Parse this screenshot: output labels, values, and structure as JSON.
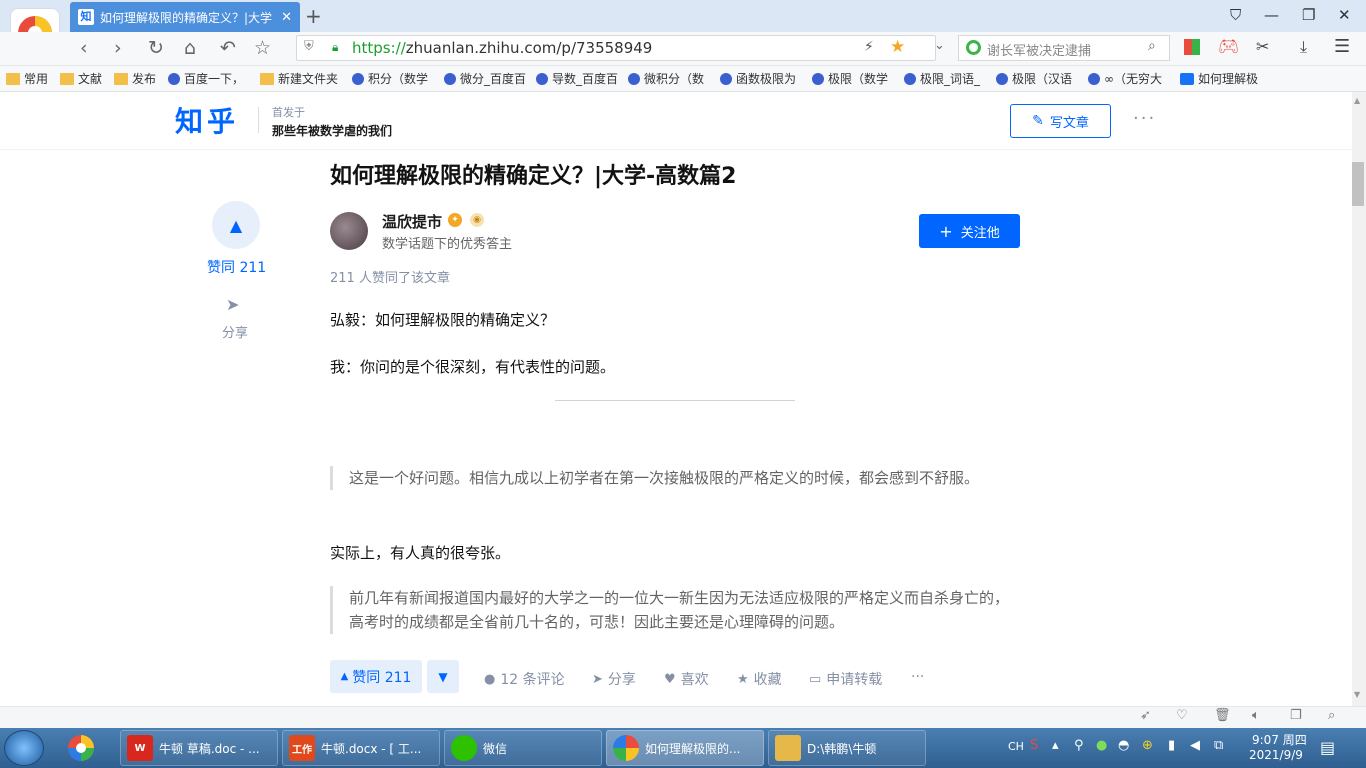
{
  "browser": {
    "tab_favicon": "知",
    "tab_title": "如何理解极限的精确定义？|大学",
    "tab_close": "✕",
    "new_tab": "+",
    "url_scheme": "https://",
    "url_host": "zhuanlan.zhihu.com",
    "url_path": "/p/73558949",
    "search_placeholder": "谢长军被决定逮捕",
    "bookmarks": [
      "常用",
      "文献",
      "发布",
      "百度一下，",
      "新建文件夹",
      "积分（数学",
      "微分_百度百",
      "导数_百度百",
      "微积分（数",
      "函数极限为",
      "极限（数学",
      "极限_词语_",
      "极限（汉语",
      "∞（无穷大",
      "如何理解极"
    ]
  },
  "zhihu": {
    "logo": "知乎",
    "published_in": "首发于",
    "column_name": "那些年被数学虐的我们",
    "write_article": "写文章",
    "more": "···"
  },
  "article": {
    "title": "如何理解极限的精确定义？|大学-高数篇2",
    "vote_count_label": "赞同 211",
    "share_label": "分享",
    "author_name": "温欣提市",
    "author_desc": "数学话题下的优秀答主",
    "follow_label": "关注他",
    "likes_line": "211 人赞同了该文章",
    "para1": "弘毅：如何理解极限的精确定义？",
    "para2": "我：你问的是个很深刻，有代表性的问题。",
    "quote1": "这是一个好问题。相信九成以上初学者在第一次接触极限的严格定义的时候，都会感到不舒服。",
    "para3": "实际上，有人真的很夸张。",
    "quote2": "前几年有新闻报道国内最好的大学之一的一位大一新生因为无法适应极限的严格定义而自杀身亡的，高考时的成绩都是全省前几十名的，可悲！因此主要还是心理障碍的问题。"
  },
  "actions": {
    "upvote": "赞同 211",
    "comments": "12 条评论",
    "share": "分享",
    "like": "喜欢",
    "collect": "收藏",
    "reprint": "申请转载",
    "more": "···"
  },
  "taskbar": {
    "items": [
      "牛顿 草稿.doc - ...",
      "牛顿.docx - [ 工...",
      "微信",
      "如何理解极限的...",
      "D:\\韩鹏\\牛顿"
    ],
    "item_icons": [
      "W",
      "工作",
      "",
      "",
      ""
    ],
    "lang": "CH",
    "time": "9:07 周四",
    "date": "2021/9/9"
  },
  "colors": {
    "zhihu_blue": "#0066ff",
    "taskbar": "#2f5f90",
    "tab_active": "#4c8fdc"
  }
}
